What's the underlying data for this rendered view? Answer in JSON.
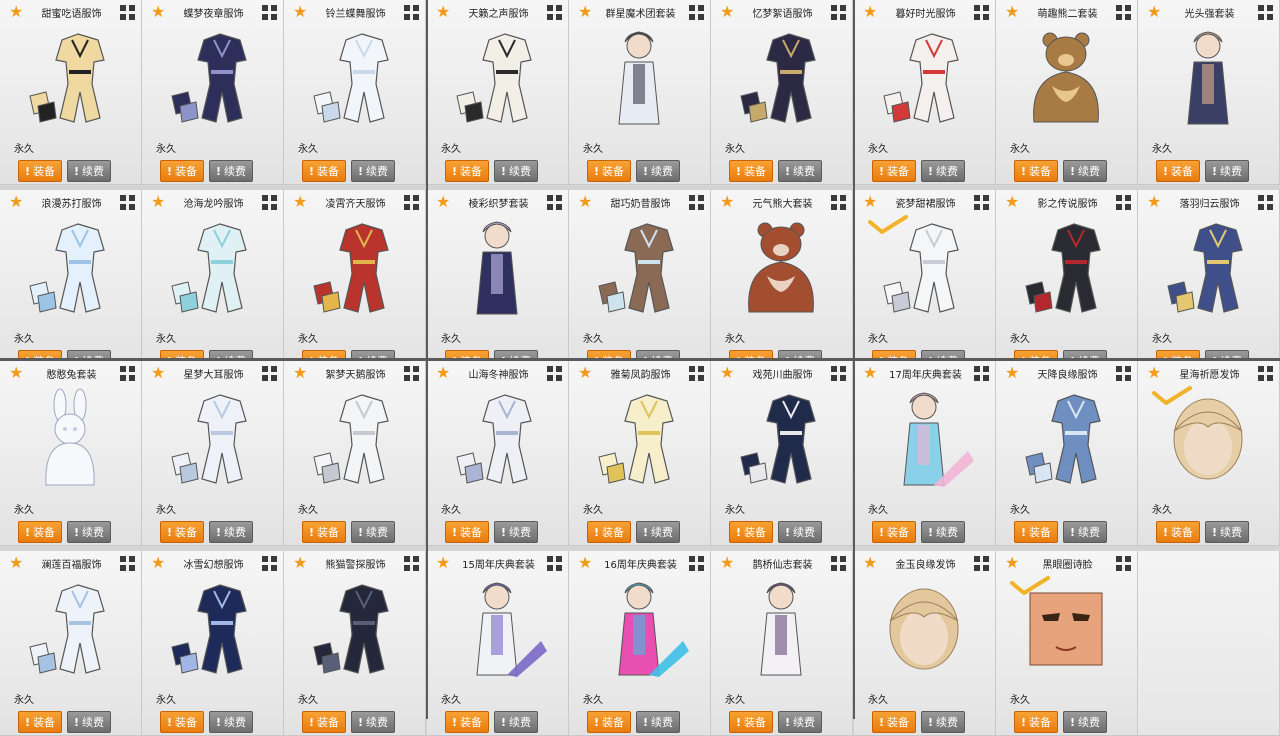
{
  "labels": {
    "duration": "永久",
    "equip": "装备",
    "renew": "续费"
  },
  "colors": {
    "star": "#f29b1b",
    "equip_button": "#ef8a1a",
    "renew_button": "#7c7c7c",
    "check": "#f0b32a"
  },
  "items": [
    {
      "name": "甜蜜吃语服饰",
      "equipped": false,
      "art": {
        "color": "#efd9a0",
        "accent": "#222222",
        "kind": "outfit"
      }
    },
    {
      "name": "蝶梦夜章服饰",
      "equipped": false,
      "art": {
        "color": "#2d2f5a",
        "accent": "#8d92c8",
        "kind": "outfit"
      }
    },
    {
      "name": "铃兰蝶舞服饰",
      "equipped": false,
      "art": {
        "color": "#f2f6fb",
        "accent": "#c9d8ea",
        "kind": "outfit"
      }
    },
    {
      "name": "天籁之声服饰",
      "equipped": false,
      "art": {
        "color": "#f1efe6",
        "accent": "#2a2a2a",
        "kind": "outfit"
      }
    },
    {
      "name": "群星魔术团套装",
      "equipped": false,
      "art": {
        "color": "#e8ecf4",
        "accent": "#3c3c4c",
        "kind": "character"
      }
    },
    {
      "name": "忆梦絮语服饰",
      "equipped": false,
      "art": {
        "color": "#2b2944",
        "accent": "#c7a96c",
        "kind": "outfit"
      }
    },
    {
      "name": "暮好时光服饰",
      "equipped": false,
      "art": {
        "color": "#f4f0ee",
        "accent": "#d23a3a",
        "kind": "outfit"
      }
    },
    {
      "name": "萌趣熊二套装",
      "equipped": false,
      "art": {
        "color": "#a87a44",
        "accent": "#e8c68e",
        "kind": "bear"
      }
    },
    {
      "name": "光头强套装",
      "equipped": false,
      "art": {
        "color": "#3a3f66",
        "accent": "#e0b48e",
        "kind": "character"
      }
    },
    {
      "name": "浪漫苏打服饰",
      "equipped": false,
      "art": {
        "color": "#e4f0fb",
        "accent": "#9dc4e6",
        "kind": "outfit"
      }
    },
    {
      "name": "沧海龙吟服饰",
      "equipped": false,
      "art": {
        "color": "#dff1f5",
        "accent": "#8fd0dd",
        "kind": "outfit"
      }
    },
    {
      "name": "凌霄齐天服饰",
      "equipped": false,
      "art": {
        "color": "#b8342c",
        "accent": "#e2b64a",
        "kind": "outfit"
      }
    },
    {
      "name": "棱彩织梦套装",
      "equipped": false,
      "art": {
        "color": "#2f3060",
        "accent": "#c8c0ef",
        "kind": "character"
      }
    },
    {
      "name": "甜巧奶昔服饰",
      "equipped": false,
      "art": {
        "color": "#8a6a55",
        "accent": "#cde3ee",
        "kind": "outfit"
      }
    },
    {
      "name": "元气熊大套装",
      "equipped": false,
      "art": {
        "color": "#a34e30",
        "accent": "#e9d2c2",
        "kind": "bear"
      }
    },
    {
      "name": "瓷梦甜裙服饰",
      "equipped": true,
      "art": {
        "color": "#f5f6f8",
        "accent": "#c7ccd6",
        "kind": "outfit"
      }
    },
    {
      "name": "影之传说服饰",
      "equipped": false,
      "art": {
        "color": "#2a2a32",
        "accent": "#b3282c",
        "kind": "outfit"
      }
    },
    {
      "name": "落羽归云服饰",
      "equipped": false,
      "art": {
        "color": "#3f4f8a",
        "accent": "#e5c770",
        "kind": "outfit"
      }
    },
    {
      "name": "憨憨兔套装",
      "equipped": false,
      "art": {
        "color": "#f7f8fb",
        "accent": "#c3cde2",
        "kind": "bunny"
      }
    },
    {
      "name": "星梦大耳服饰",
      "equipped": false,
      "art": {
        "color": "#eef2f8",
        "accent": "#b8c9df",
        "kind": "outfit"
      }
    },
    {
      "name": "絮梦天鹅服饰",
      "equipped": false,
      "art": {
        "color": "#f4f5f7",
        "accent": "#c6c9d1",
        "kind": "outfit"
      }
    },
    {
      "name": "山海冬神服饰",
      "equipped": false,
      "art": {
        "color": "#eef0f6",
        "accent": "#aab4d4",
        "kind": "outfit"
      }
    },
    {
      "name": "雅菊凤韵服饰",
      "equipped": false,
      "art": {
        "color": "#f7efcc",
        "accent": "#e0c35a",
        "kind": "outfit"
      }
    },
    {
      "name": "戏苑川曲服饰",
      "equipped": false,
      "art": {
        "color": "#202a4a",
        "accent": "#e8e8ec",
        "kind": "outfit"
      }
    },
    {
      "name": "17周年庆典套装",
      "equipped": false,
      "art": {
        "color": "#8ad0e8",
        "accent": "#f3b4d6",
        "kind": "anniversary"
      }
    },
    {
      "name": "天降良缘服饰",
      "equipped": false,
      "art": {
        "color": "#6e8fc0",
        "accent": "#d9e5f2",
        "kind": "outfit"
      }
    },
    {
      "name": "星海祈愿发饰",
      "equipped": true,
      "art": {
        "color": "#e6cfa6",
        "accent": "#f0dcc6",
        "kind": "hair"
      }
    },
    {
      "name": "澜莲百福服饰",
      "equipped": false,
      "art": {
        "color": "#eef3fa",
        "accent": "#a8c2e2",
        "kind": "outfit"
      }
    },
    {
      "name": "冰雪幻想服饰",
      "equipped": false,
      "art": {
        "color": "#1e2a5a",
        "accent": "#9fb6e6",
        "kind": "outfit"
      }
    },
    {
      "name": "熊猫警探服饰",
      "equipped": false,
      "art": {
        "color": "#25283a",
        "accent": "#5a5f78",
        "kind": "outfit"
      }
    },
    {
      "name": "15周年庆典套装",
      "equipped": false,
      "art": {
        "color": "#f1f2f5",
        "accent": "#7a68c8",
        "kind": "anniversary"
      }
    },
    {
      "name": "16周年庆典套装",
      "equipped": false,
      "art": {
        "color": "#e84fb0",
        "accent": "#3ec0e8",
        "kind": "anniversary"
      }
    },
    {
      "name": "鹊桥仙志套装",
      "equipped": false,
      "art": {
        "color": "#f3f1f6",
        "accent": "#6a4c7c",
        "kind": "character"
      }
    },
    {
      "name": "金玉良缘发饰",
      "equipped": false,
      "art": {
        "color": "#e3c79d",
        "accent": "#f0dcc6",
        "kind": "hair"
      }
    },
    {
      "name": "黑眼圈诗脸",
      "equipped": true,
      "art": {
        "color": "#e7a37c",
        "accent": "#2a1a14",
        "kind": "face"
      }
    }
  ]
}
